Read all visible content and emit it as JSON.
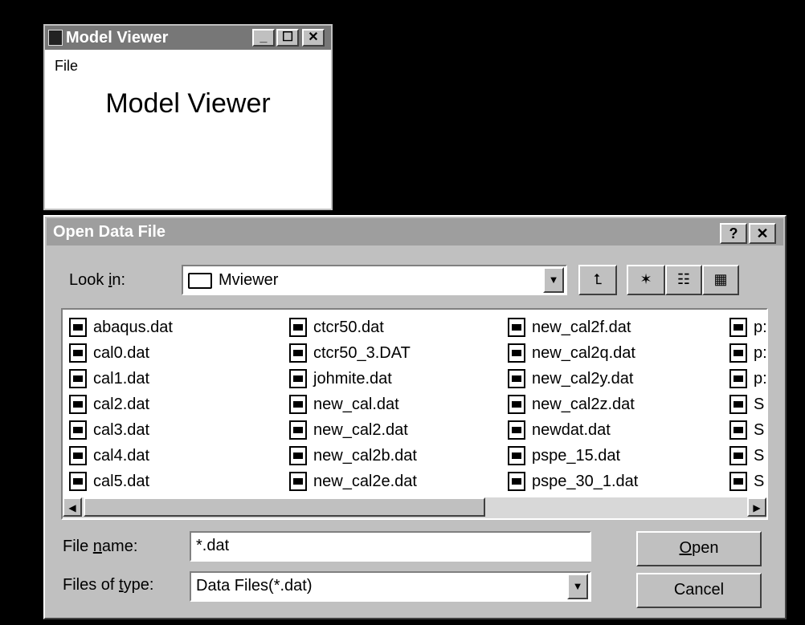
{
  "model_viewer": {
    "title": "Model Viewer",
    "minimize": "_",
    "maximize": "☐",
    "close": "✕",
    "menu_file": "File",
    "heading": "Model Viewer"
  },
  "dialog": {
    "title": "Open Data File",
    "help_btn": "?",
    "close_btn": "✕",
    "look_in_label_pre": "Look ",
    "look_in_label_u": "i",
    "look_in_label_post": "n:",
    "look_in_value": "Mviewer",
    "files": [
      [
        "abaqus.dat",
        "cal0.dat",
        "cal1.dat",
        "cal2.dat",
        "cal3.dat",
        "cal4.dat",
        "cal5.dat"
      ],
      [
        "ctcr50.dat",
        "ctcr50_3.DAT",
        "johmite.dat",
        "new_cal.dat",
        "new_cal2.dat",
        "new_cal2b.dat",
        "new_cal2e.dat"
      ],
      [
        "new_cal2f.dat",
        "new_cal2q.dat",
        "new_cal2y.dat",
        "new_cal2z.dat",
        "newdat.dat",
        "pspe_15.dat",
        "pspe_30_1.dat"
      ],
      [
        "p:",
        "p:",
        "p:",
        "S",
        "S",
        "S",
        "S"
      ]
    ],
    "file_name_label_pre": "File ",
    "file_name_label_u": "n",
    "file_name_label_post": "ame:",
    "file_name_value": "*.dat",
    "files_type_label_pre": "Files of ",
    "files_type_label_u": "t",
    "files_type_label_post": "ype:",
    "files_type_value": "Data Files(*.dat)",
    "open_btn_u": "O",
    "open_btn_rest": "pen",
    "cancel_btn": "Cancel"
  }
}
